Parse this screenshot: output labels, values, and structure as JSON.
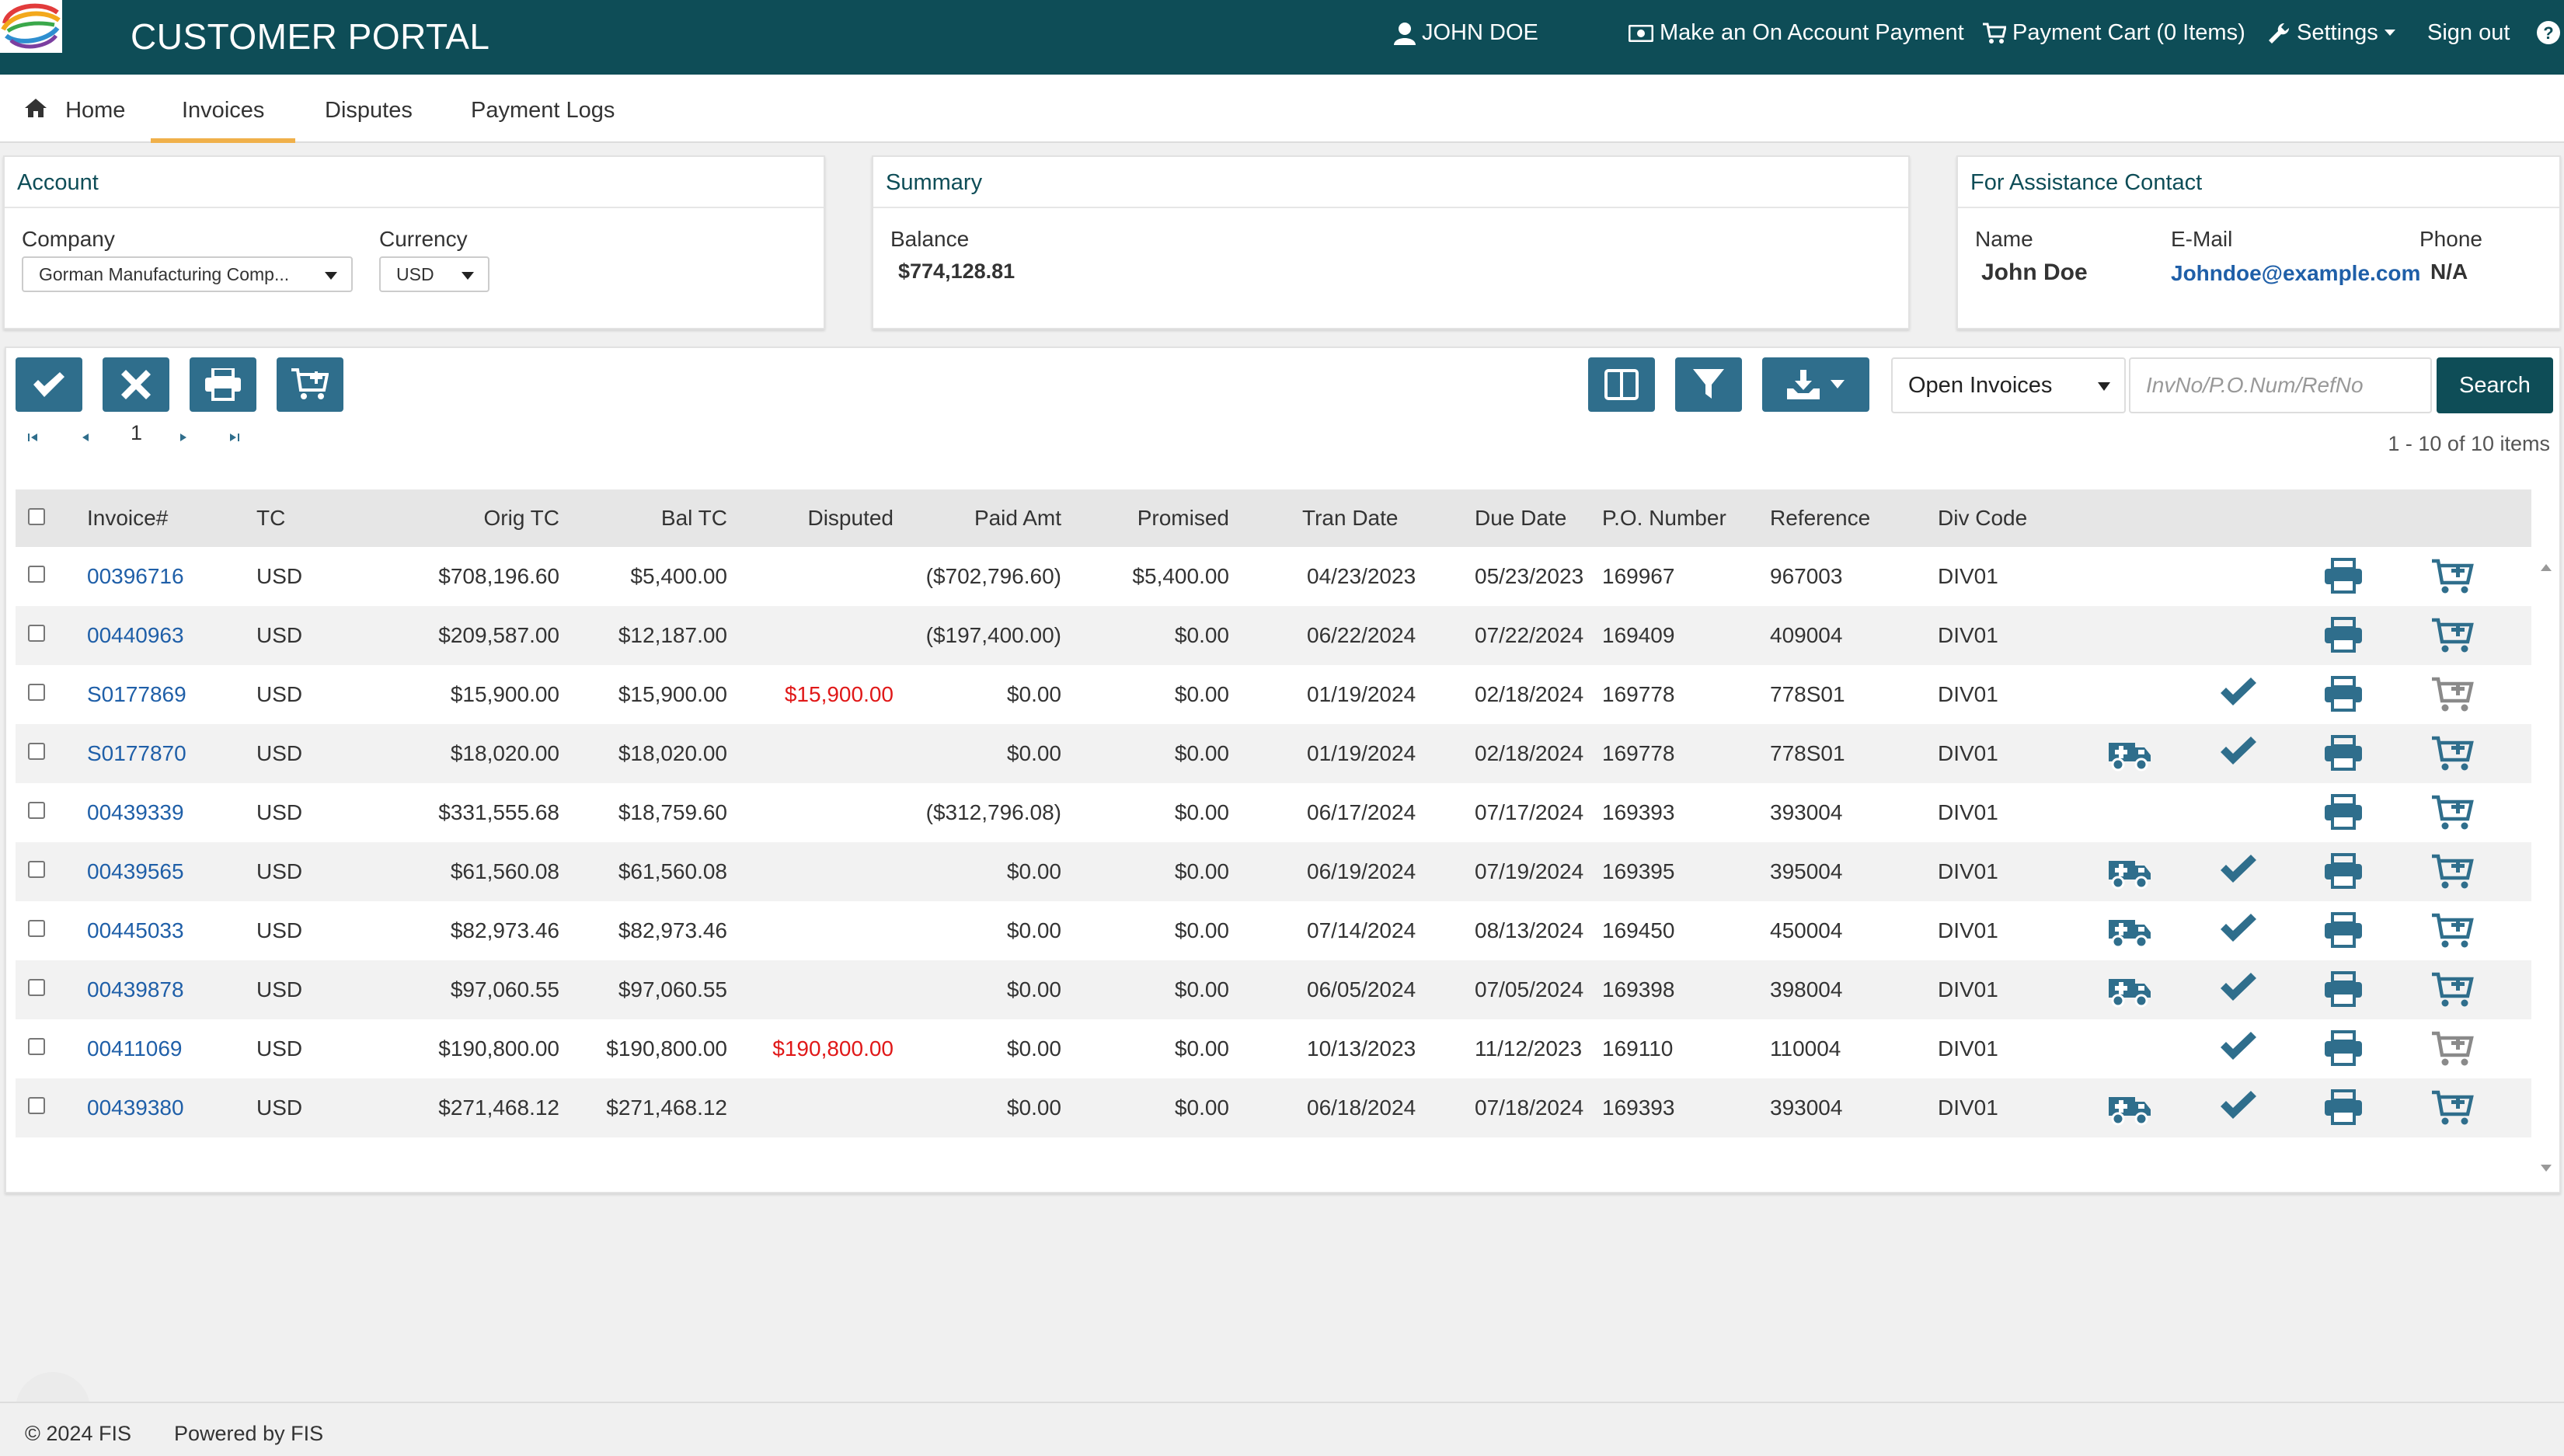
{
  "header": {
    "title": "CUSTOMER PORTAL",
    "user": "JOHN DOE",
    "on_account_payment": "Make an On Account Payment",
    "payment_cart": "Payment Cart (0 Items)",
    "settings": "Settings",
    "sign_out": "Sign out",
    "help_icon": "question-circle-icon"
  },
  "tabs": [
    {
      "label": "Home",
      "icon": "home-icon",
      "active": false
    },
    {
      "label": "Invoices",
      "active": true
    },
    {
      "label": "Disputes",
      "active": false
    },
    {
      "label": "Payment Logs",
      "active": false
    }
  ],
  "account": {
    "title": "Account",
    "company_label": "Company",
    "company_value": "Gorman Manufacturing Comp...",
    "currency_label": "Currency",
    "currency_value": "USD"
  },
  "summary": {
    "title": "Summary",
    "balance_label": "Balance",
    "balance_value": "$774,128.81"
  },
  "assistance": {
    "title": "For Assistance Contact",
    "name_label": "Name",
    "name_value": "John Doe",
    "email_label": "E-Mail",
    "email_value": "Johndoe@example.com",
    "phone_label": "Phone",
    "phone_value": "N/A"
  },
  "toolbar": {
    "filter_select": "Open Invoices",
    "search_placeholder": "InvNo/P.O.Num/RefNo",
    "search_button": "Search",
    "page_number": "1",
    "page_count": "1 - 10 of 10 items"
  },
  "columns": [
    "Invoice#",
    "TC",
    "Orig TC",
    "Bal TC",
    "Disputed",
    "Paid Amt",
    "Promised",
    "Tran Date",
    "Due Date",
    "P.O. Number",
    "Reference",
    "Div Code"
  ],
  "rows": [
    {
      "invoice": "00396716",
      "tc": "USD",
      "orig": "$708,196.60",
      "bal": "$5,400.00",
      "disputed": "",
      "paid": "($702,796.60)",
      "promised": "$5,400.00",
      "tran": "04/23/2023",
      "due": "05/23/2023",
      "po": "169967",
      "ref": "967003",
      "div": "DIV01",
      "ambulance": false,
      "check": false,
      "cart_active": true
    },
    {
      "invoice": "00440963",
      "tc": "USD",
      "orig": "$209,587.00",
      "bal": "$12,187.00",
      "disputed": "",
      "paid": "($197,400.00)",
      "promised": "$0.00",
      "tran": "06/22/2024",
      "due": "07/22/2024",
      "po": "169409",
      "ref": "409004",
      "div": "DIV01",
      "ambulance": false,
      "check": false,
      "cart_active": true
    },
    {
      "invoice": "S0177869",
      "tc": "USD",
      "orig": "$15,900.00",
      "bal": "$15,900.00",
      "disputed": "$15,900.00",
      "paid": "$0.00",
      "promised": "$0.00",
      "tran": "01/19/2024",
      "due": "02/18/2024",
      "po": "169778",
      "ref": "778S01",
      "div": "DIV01",
      "ambulance": false,
      "check": true,
      "cart_active": false
    },
    {
      "invoice": "S0177870",
      "tc": "USD",
      "orig": "$18,020.00",
      "bal": "$18,020.00",
      "disputed": "",
      "paid": "$0.00",
      "promised": "$0.00",
      "tran": "01/19/2024",
      "due": "02/18/2024",
      "po": "169778",
      "ref": "778S01",
      "div": "DIV01",
      "ambulance": true,
      "check": true,
      "cart_active": true
    },
    {
      "invoice": "00439339",
      "tc": "USD",
      "orig": "$331,555.68",
      "bal": "$18,759.60",
      "disputed": "",
      "paid": "($312,796.08)",
      "promised": "$0.00",
      "tran": "06/17/2024",
      "due": "07/17/2024",
      "po": "169393",
      "ref": "393004",
      "div": "DIV01",
      "ambulance": false,
      "check": false,
      "cart_active": true
    },
    {
      "invoice": "00439565",
      "tc": "USD",
      "orig": "$61,560.08",
      "bal": "$61,560.08",
      "disputed": "",
      "paid": "$0.00",
      "promised": "$0.00",
      "tran": "06/19/2024",
      "due": "07/19/2024",
      "po": "169395",
      "ref": "395004",
      "div": "DIV01",
      "ambulance": true,
      "check": true,
      "cart_active": true
    },
    {
      "invoice": "00445033",
      "tc": "USD",
      "orig": "$82,973.46",
      "bal": "$82,973.46",
      "disputed": "",
      "paid": "$0.00",
      "promised": "$0.00",
      "tran": "07/14/2024",
      "due": "08/13/2024",
      "po": "169450",
      "ref": "450004",
      "div": "DIV01",
      "ambulance": true,
      "check": true,
      "cart_active": true
    },
    {
      "invoice": "00439878",
      "tc": "USD",
      "orig": "$97,060.55",
      "bal": "$97,060.55",
      "disputed": "",
      "paid": "$0.00",
      "promised": "$0.00",
      "tran": "06/05/2024",
      "due": "07/05/2024",
      "po": "169398",
      "ref": "398004",
      "div": "DIV01",
      "ambulance": true,
      "check": true,
      "cart_active": true
    },
    {
      "invoice": "00411069",
      "tc": "USD",
      "orig": "$190,800.00",
      "bal": "$190,800.00",
      "disputed": "$190,800.00",
      "paid": "$0.00",
      "promised": "$0.00",
      "tran": "10/13/2023",
      "due": "11/12/2023",
      "po": "169110",
      "ref": "110004",
      "div": "DIV01",
      "ambulance": false,
      "check": true,
      "cart_active": false
    },
    {
      "invoice": "00439380",
      "tc": "USD",
      "orig": "$271,468.12",
      "bal": "$271,468.12",
      "disputed": "",
      "paid": "$0.00",
      "promised": "$0.00",
      "tran": "06/18/2024",
      "due": "07/18/2024",
      "po": "169393",
      "ref": "393004",
      "div": "DIV01",
      "ambulance": true,
      "check": true,
      "cart_active": true
    }
  ],
  "footer": {
    "copyright": "© 2024 FIS",
    "powered": "Powered by FIS"
  },
  "colors": {
    "header_bg": "#0e4d57",
    "button_bg": "#2f6e8c",
    "tab_accent": "#f0b04a",
    "link": "#1f5fa8",
    "disputed": "#e01818",
    "cart_inactive": "#8a8a8a"
  }
}
